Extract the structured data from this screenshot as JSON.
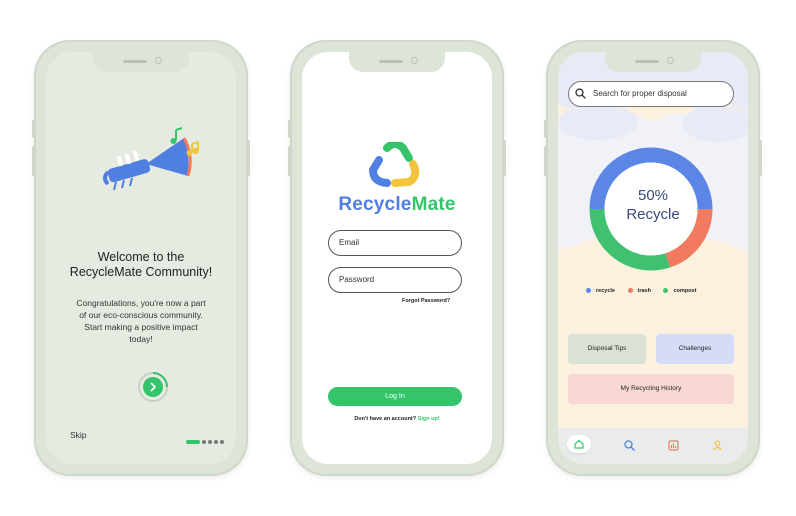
{
  "welcome_screen": {
    "title": "Welcome to the RecycleMate Community!",
    "body": "Congratulations, you're now a part of our eco-conscious community. Start making a positive impact today!",
    "next_icon": "chevron-right-icon",
    "skip_label": "Skip",
    "illustration": "trumpet-with-music-notes",
    "page_dots": {
      "count": 5,
      "active": 0
    }
  },
  "login_screen": {
    "brand_part1": "Recycle",
    "brand_part2": "Mate",
    "email_placeholder": "Email",
    "password_placeholder": "Password",
    "forgot_password": "Forgot Password?",
    "login_label": "Log In",
    "signup_prompt": "Don't have an account?",
    "signup_link": "Sign up!"
  },
  "home_screen": {
    "search_placeholder": "Search for proper disposal",
    "donut_percent": "50%",
    "donut_label": "Recycle",
    "legend": [
      {
        "label": "recycle",
        "color": "#5b86e5"
      },
      {
        "label": "trash",
        "color": "#f27a5e"
      },
      {
        "label": "compost",
        "color": "#3fc16f"
      }
    ],
    "donut_shares": {
      "recycle": 0.5,
      "trash": 0.2,
      "compost": 0.3
    },
    "cards": {
      "tips": "Disposal Tips",
      "challenges": "Challenges",
      "history": "My Recycling History"
    },
    "nav": [
      "home-icon",
      "search-icon",
      "chart-icon",
      "profile-icon"
    ]
  },
  "colors": {
    "green": "#34c56b",
    "blue": "#5b86e5",
    "coral": "#f27a5e",
    "phone_frame": "#dde4d8"
  }
}
